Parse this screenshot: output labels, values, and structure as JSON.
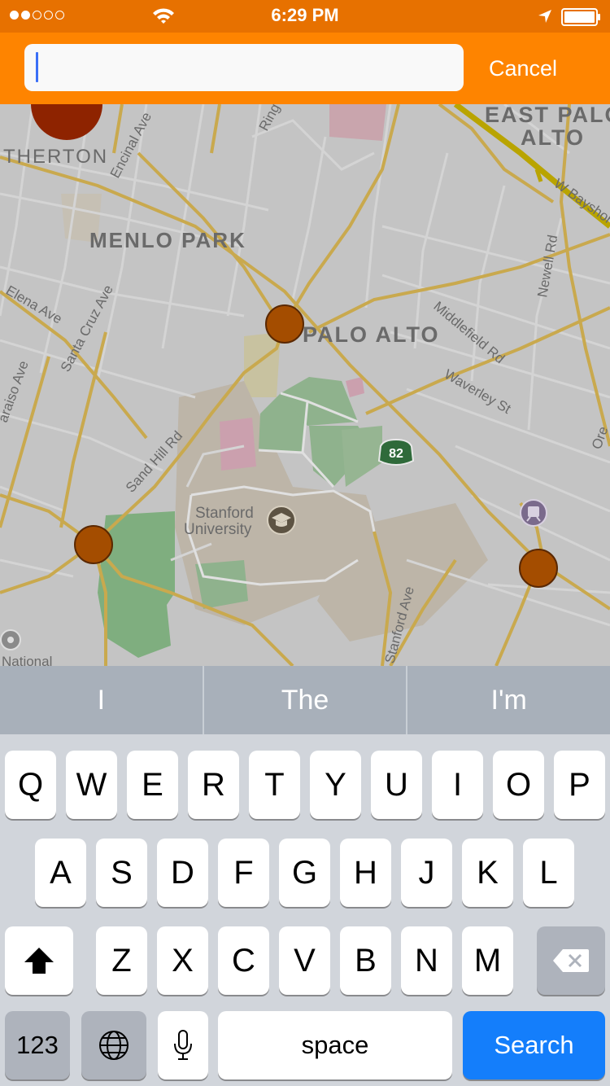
{
  "status_bar": {
    "time": "6:29 PM",
    "signal_dots_filled": 2,
    "signal_dots_total": 5,
    "icons": [
      "wifi-icon",
      "location-arrow-icon",
      "battery-icon"
    ]
  },
  "search": {
    "placeholder": "",
    "value": "",
    "cancel_label": "Cancel"
  },
  "map": {
    "labels": {
      "east_palo_alto_line1": "EAST PALO",
      "east_palo_alto_line2": "ALTO",
      "atherton": "THERTON",
      "menlo_park": "MENLO PARK",
      "palo_alto": "PALO ALTO",
      "stanford_line1": "Stanford",
      "stanford_line2": "University",
      "national": "National",
      "encinal_ave": "Encinal Ave",
      "ring": "Ring",
      "w_bayshore": "W Bayshore",
      "newell_rd": "Newell Rd",
      "elena_ave": "Elena Ave",
      "santa_cruz_ave": "Santa Cruz Ave",
      "alameda": "araiso Ave",
      "middlefield_rd": "Middlefield Rd",
      "waverley_st": "Waverley St",
      "sand_hill_rd": "Sand Hill Rd",
      "stanford_ave": "Stanford Ave",
      "ore": "Ore",
      "route_82": "82"
    },
    "icons": [
      "graduation-cap-icon",
      "train-station-icon",
      "highway-shield-icon"
    ]
  },
  "suggestions": [
    "I",
    "The",
    "I'm"
  ],
  "keyboard": {
    "row1": [
      "Q",
      "W",
      "E",
      "R",
      "T",
      "Y",
      "U",
      "I",
      "O",
      "P"
    ],
    "row2": [
      "A",
      "S",
      "D",
      "F",
      "G",
      "H",
      "J",
      "K",
      "L"
    ],
    "row3": [
      "Z",
      "X",
      "C",
      "V",
      "B",
      "N",
      "M"
    ],
    "numbers_label": "123",
    "space_label": "space",
    "search_label": "Search",
    "icons": [
      "shift-icon",
      "backspace-icon",
      "globe-icon",
      "microphone-icon"
    ]
  },
  "colors": {
    "status_bar": "#e77100",
    "header": "#fe8400",
    "pin": "#a44d00",
    "search_key": "#147efb"
  }
}
